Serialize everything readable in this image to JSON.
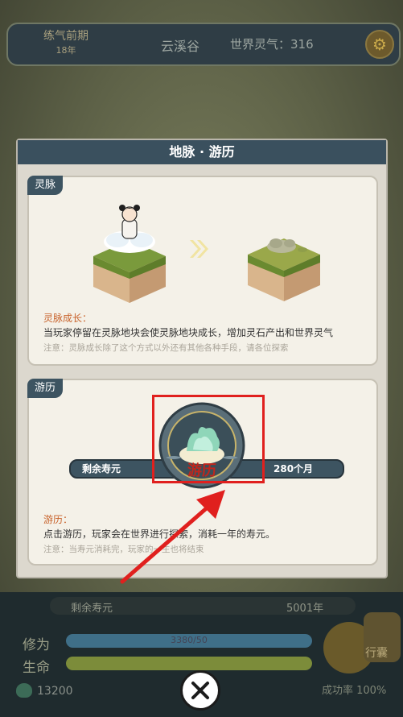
{
  "background": {
    "realm": "练气前期",
    "realm_years": "18年",
    "location": "云溪谷",
    "world_qi": "世界灵气：316",
    "remaining_life_label": "剩余寿元",
    "remaining_life_value": "5001年",
    "cultivation_label": "修为",
    "cultivation_value": "3380/50",
    "life_label": "生命",
    "spirit_stones": "13200",
    "bag_label": "行囊",
    "success_rate": "成功率 100%",
    "gear_icon": "gear-icon"
  },
  "dialog": {
    "title": "地脉 · 游历",
    "vein": {
      "tag": "灵脉",
      "subtitle": "灵脉成长：",
      "desc": "当玩家停留在灵脉地块会使灵脉地块成长，增加灵石产出和世界灵气",
      "note": "注意：灵脉成长除了这个方式以外还有其他各种手段，请各位探索"
    },
    "travel": {
      "tag": "游历",
      "life_label": "剩余寿元",
      "life_value": "280个月",
      "button_label": "游历",
      "subtitle": "游历：",
      "desc": "点击游历，玩家会在世界进行探索，消耗一年的寿元。",
      "note": "注意：当寿元消耗完，玩家的一生也将结束"
    }
  },
  "colors": {
    "header": "#3a505e",
    "highlight": "#e0201e",
    "subtitle": "#c8632c"
  },
  "close_icon": "close-icon"
}
